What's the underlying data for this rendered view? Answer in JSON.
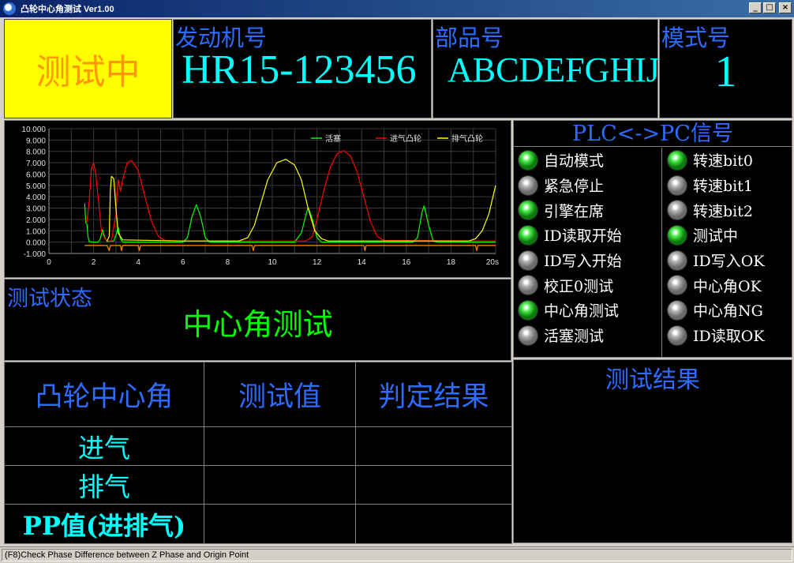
{
  "window": {
    "title": "凸轮中心角测试 Ver1.00"
  },
  "header": {
    "status": "测试中",
    "engine_label": "发动机号",
    "engine_value": "HR15-123456",
    "part_label": "部品号",
    "part_value": "ABCDEFGHIJ",
    "mode_label": "模式号",
    "mode_value": "1"
  },
  "chart_data": {
    "type": "line",
    "xlabel": "",
    "ylabel": "",
    "xlim": [
      0,
      20
    ],
    "ylim": [
      -1,
      10
    ],
    "x_ticks": [
      "0",
      "2",
      "4",
      "6",
      "8",
      "10",
      "12",
      "14",
      "16",
      "18",
      "20s"
    ],
    "y_ticks": [
      "10.000",
      "9.000",
      "8.000",
      "7.000",
      "6.000",
      "5.000",
      "4.000",
      "3.000",
      "2.000",
      "1.000",
      "0.000",
      "-1.000"
    ],
    "grid": true,
    "legend_position": "top-right",
    "series": [
      {
        "name": "活塞",
        "color": "#00ff00",
        "points": [
          [
            1.6,
            3.4
          ],
          [
            1.65,
            1.7
          ],
          [
            1.7,
            1.6
          ],
          [
            1.75,
            0.5
          ],
          [
            1.8,
            0.05
          ],
          [
            2.0,
            0.0
          ],
          [
            2.2,
            0.0
          ],
          [
            2.3,
            0.3
          ],
          [
            2.4,
            1.1
          ],
          [
            2.5,
            0.4
          ],
          [
            2.6,
            0.05
          ],
          [
            2.9,
            0.1
          ],
          [
            3.0,
            0.6
          ],
          [
            3.1,
            1.3
          ],
          [
            3.2,
            0.3
          ],
          [
            3.3,
            0.0
          ],
          [
            6.0,
            0.0
          ],
          [
            6.2,
            0.4
          ],
          [
            6.4,
            2.2
          ],
          [
            6.6,
            3.3
          ],
          [
            6.8,
            2.2
          ],
          [
            7.0,
            0.4
          ],
          [
            7.2,
            0.0
          ],
          [
            11.0,
            0.0
          ],
          [
            11.3,
            0.8
          ],
          [
            11.6,
            3.1
          ],
          [
            11.8,
            2.0
          ],
          [
            12.0,
            0.4
          ],
          [
            12.2,
            0.0
          ],
          [
            16.3,
            0.0
          ],
          [
            16.5,
            0.4
          ],
          [
            16.7,
            2.6
          ],
          [
            16.8,
            3.2
          ],
          [
            17.0,
            1.5
          ],
          [
            17.2,
            0.1
          ],
          [
            17.4,
            0.0
          ],
          [
            20.0,
            0.0
          ]
        ]
      },
      {
        "name": "进气凸轮",
        "color": "#ff0000",
        "points": [
          [
            1.6,
            2.0
          ],
          [
            1.7,
            1.8
          ],
          [
            1.8,
            3.5
          ],
          [
            1.9,
            6.5
          ],
          [
            2.0,
            7.0
          ],
          [
            2.1,
            6.0
          ],
          [
            2.25,
            3.0
          ],
          [
            2.35,
            1.0
          ],
          [
            2.5,
            0.3
          ],
          [
            2.6,
            0.1
          ],
          [
            2.8,
            0.1
          ],
          [
            3.0,
            2.5
          ],
          [
            3.1,
            5.5
          ],
          [
            3.2,
            4.5
          ],
          [
            3.3,
            5.5
          ],
          [
            3.5,
            7.0
          ],
          [
            3.7,
            7.2
          ],
          [
            4.0,
            6.3
          ],
          [
            4.3,
            4.0
          ],
          [
            4.6,
            1.8
          ],
          [
            4.9,
            0.5
          ],
          [
            5.2,
            0.15
          ],
          [
            6.0,
            0.1
          ],
          [
            11.5,
            0.1
          ],
          [
            11.8,
            0.5
          ],
          [
            12.0,
            2.0
          ],
          [
            12.3,
            4.5
          ],
          [
            12.6,
            6.6
          ],
          [
            12.9,
            7.8
          ],
          [
            13.2,
            8.05
          ],
          [
            13.5,
            7.6
          ],
          [
            13.8,
            6.2
          ],
          [
            14.1,
            4.0
          ],
          [
            14.4,
            1.8
          ],
          [
            14.7,
            0.5
          ],
          [
            15.0,
            0.15
          ],
          [
            20.0,
            0.1
          ]
        ]
      },
      {
        "name": "排气凸轮",
        "color": "#ffff00",
        "points": [
          [
            2.6,
            0.1
          ],
          [
            2.7,
            0.5
          ],
          [
            2.75,
            4.5
          ],
          [
            2.8,
            5.8
          ],
          [
            2.9,
            5.6
          ],
          [
            3.0,
            3.0
          ],
          [
            3.1,
            0.8
          ],
          [
            3.3,
            0.2
          ],
          [
            6.0,
            0.1
          ],
          [
            8.5,
            0.1
          ],
          [
            8.9,
            0.4
          ],
          [
            9.2,
            1.5
          ],
          [
            9.5,
            3.5
          ],
          [
            9.8,
            5.5
          ],
          [
            10.2,
            7.0
          ],
          [
            10.6,
            7.3
          ],
          [
            11.0,
            6.8
          ],
          [
            11.3,
            5.5
          ],
          [
            11.6,
            3.0
          ],
          [
            11.9,
            1.0
          ],
          [
            12.2,
            0.3
          ],
          [
            12.5,
            0.1
          ],
          [
            18.8,
            0.1
          ],
          [
            19.1,
            0.3
          ],
          [
            19.4,
            1.0
          ],
          [
            19.7,
            2.5
          ],
          [
            20.0,
            5.0
          ]
        ]
      },
      {
        "name": "",
        "color": "#ff8c00",
        "points": [
          [
            1.6,
            -0.3
          ],
          [
            2.6,
            -0.3
          ],
          [
            2.7,
            -0.75
          ],
          [
            2.75,
            -0.3
          ],
          [
            3.2,
            -0.3
          ],
          [
            3.25,
            -0.75
          ],
          [
            3.3,
            -0.3
          ],
          [
            4.0,
            -0.3
          ],
          [
            4.05,
            -0.75
          ],
          [
            4.1,
            -0.3
          ],
          [
            9.1,
            -0.3
          ],
          [
            9.15,
            -0.75
          ],
          [
            9.2,
            -0.3
          ],
          [
            14.1,
            -0.3
          ],
          [
            14.15,
            -0.75
          ],
          [
            14.2,
            -0.3
          ],
          [
            19.1,
            -0.3
          ],
          [
            19.15,
            -0.75
          ],
          [
            19.2,
            -0.3
          ],
          [
            20.0,
            -0.3
          ]
        ]
      }
    ]
  },
  "test_state": {
    "label": "测试状态",
    "value": "中心角测试"
  },
  "results": {
    "headers": [
      "凸轮中心角",
      "测试值",
      "判定结果"
    ],
    "rows": [
      {
        "label": "进气",
        "value": "",
        "result": ""
      },
      {
        "label": "排气",
        "value": "",
        "result": ""
      },
      {
        "label": "PP值(进排气)",
        "value": "",
        "result": ""
      }
    ]
  },
  "plc": {
    "title": "PLC<->PC信号",
    "left": [
      {
        "label": "自动模式",
        "on": true
      },
      {
        "label": "紧急停止",
        "on": false
      },
      {
        "label": "引擎在席",
        "on": true
      },
      {
        "label": "ID读取开始",
        "on": true
      },
      {
        "label": "ID写入开始",
        "on": false
      },
      {
        "label": "校正0测试",
        "on": false
      },
      {
        "label": "中心角测试",
        "on": true
      },
      {
        "label": "活塞测试",
        "on": false
      }
    ],
    "right": [
      {
        "label": "转速bit0",
        "on": true
      },
      {
        "label": "转速bit1",
        "on": false
      },
      {
        "label": "转速bit2",
        "on": false
      },
      {
        "label": "测试中",
        "on": true
      },
      {
        "label": "ID写入OK",
        "on": false
      },
      {
        "label": "中心角OK",
        "on": false
      },
      {
        "label": "中心角NG",
        "on": false
      },
      {
        "label": "ID读取OK",
        "on": false
      }
    ]
  },
  "test_result": {
    "label": "测试结果"
  },
  "statusbar": {
    "text": "(F8)Check Phase Difference  between Z Phase and Origin Point"
  },
  "colors": {
    "title_blue": "#2e6bff",
    "value_cyan": "#00ffff",
    "status_yellow": "#ffff00",
    "status_orange": "#ff9900",
    "state_green": "#00ff00"
  }
}
